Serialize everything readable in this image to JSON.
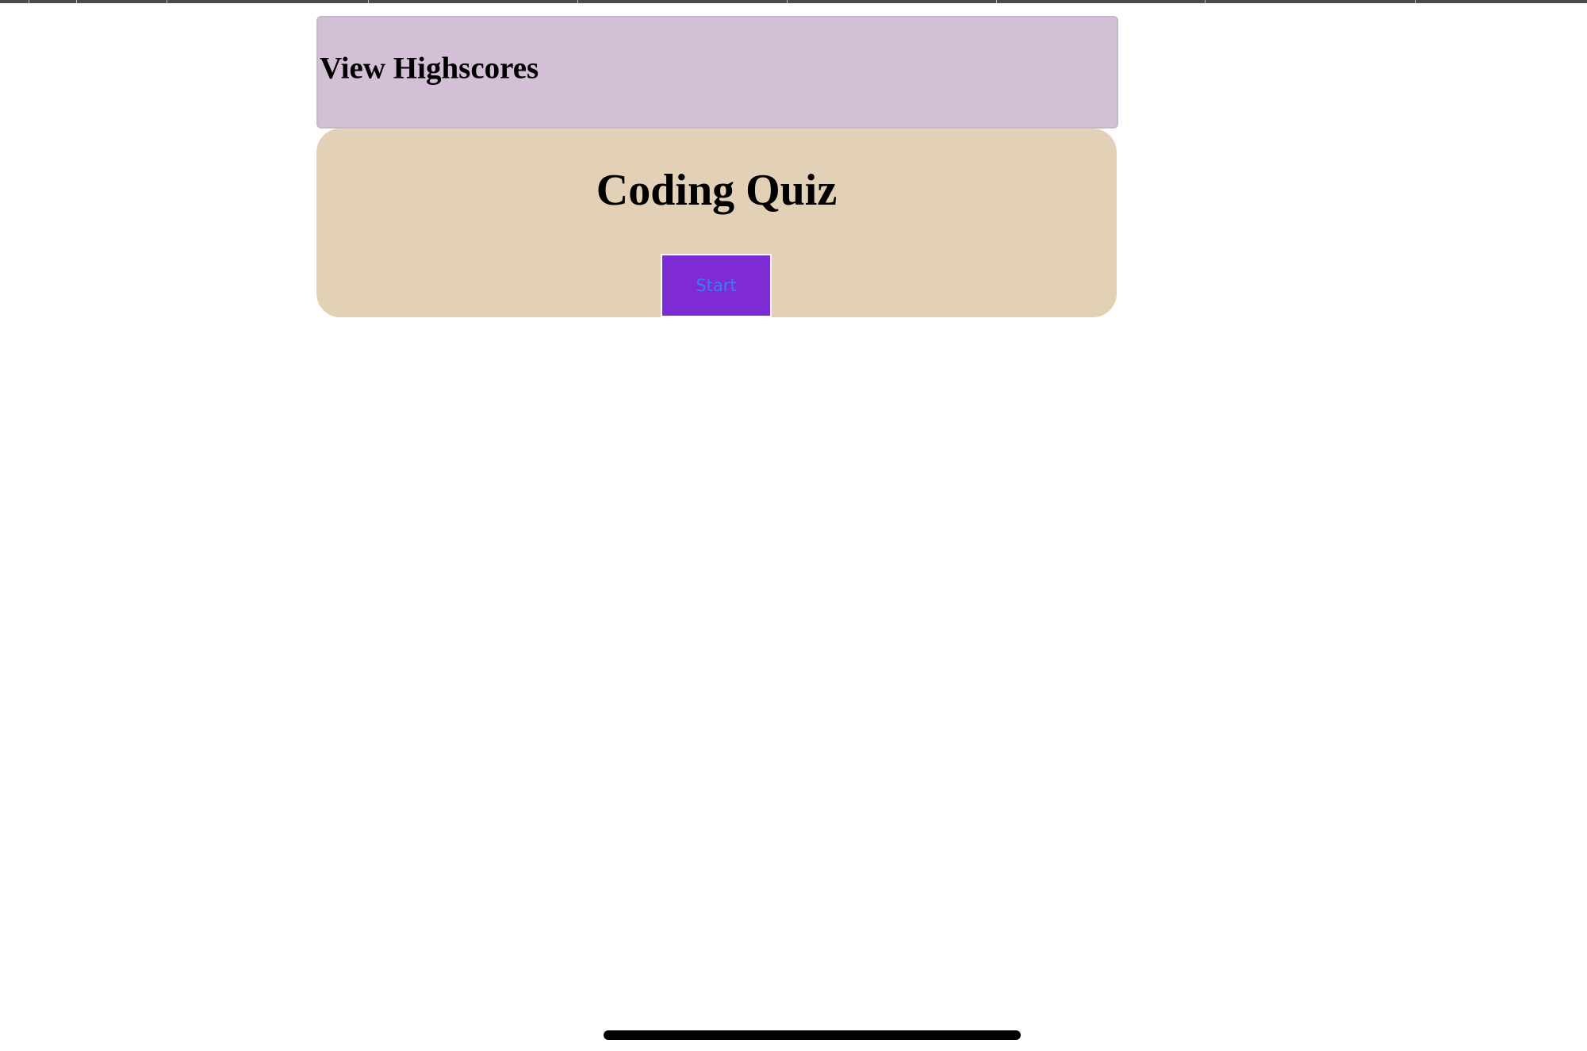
{
  "header": {
    "highscores_label": "View Highscores"
  },
  "quiz": {
    "title": "Coding Quiz",
    "start_label": "Start"
  },
  "colors": {
    "header_bg": "#d4c0d6",
    "quiz_bg": "#e2d1b6",
    "start_button_bg": "#7f2bd4",
    "start_button_text": "#3c7cf2",
    "home_indicator": "#000000"
  }
}
